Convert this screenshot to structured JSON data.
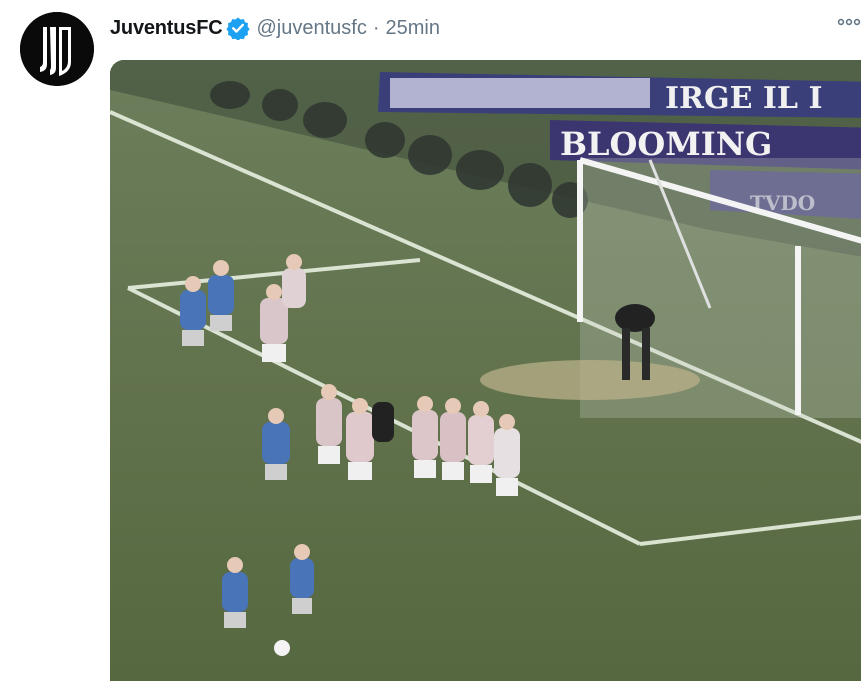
{
  "tweet": {
    "display_name": "JuventusFC",
    "handle": "@juventusfc",
    "separator": "·",
    "timestamp": "25min"
  },
  "media": {
    "banner_top": "IRGE IL I",
    "banner_bottom": "BLOOMING",
    "banner_lower": "TVDO"
  },
  "icons": {
    "avatar": "juventus-logo",
    "verified": "verified-badge-icon",
    "more": "more-options-icon"
  },
  "colors": {
    "verified_blue": "#1da1f2",
    "name_text": "#14171a",
    "secondary_text": "#657786",
    "pitch_green": "#5f7050"
  }
}
